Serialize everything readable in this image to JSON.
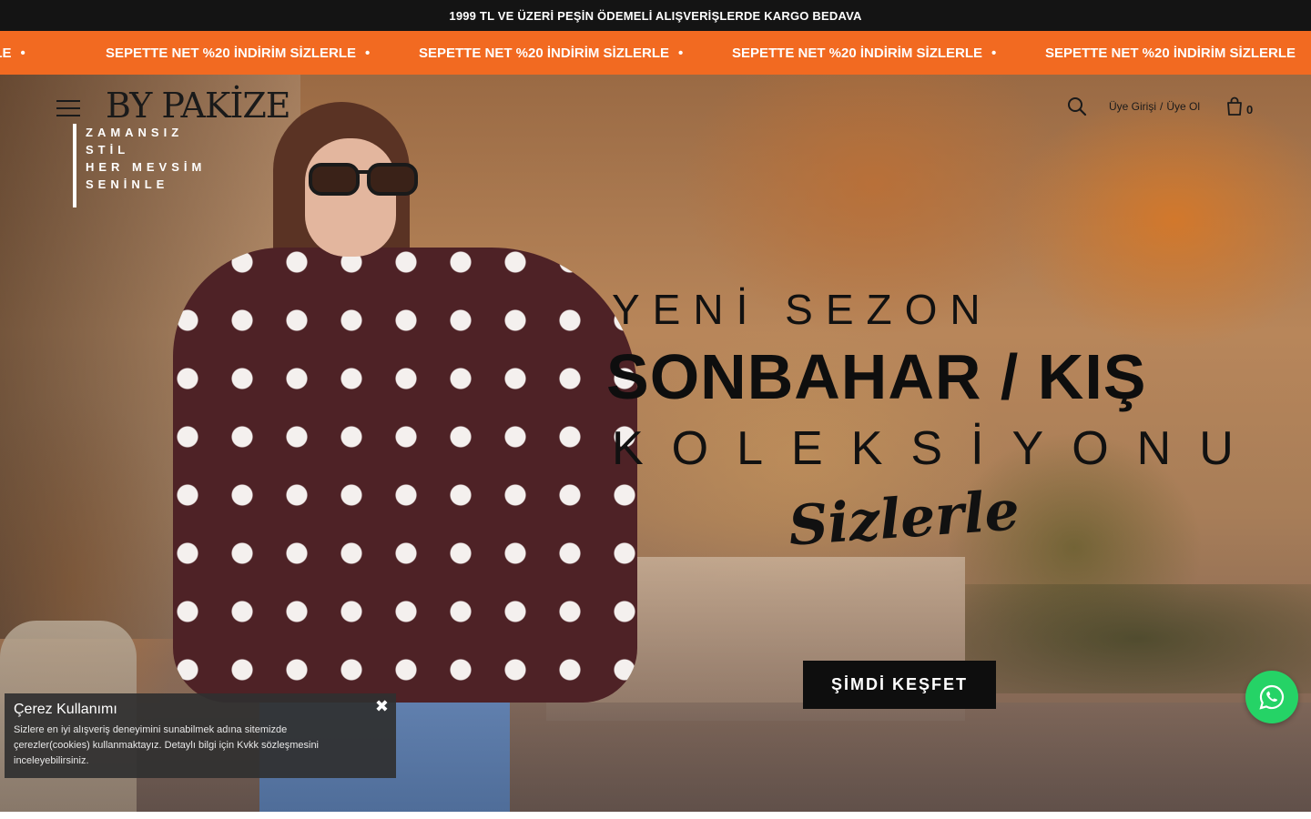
{
  "topbar": {
    "text": "1999 TL VE ÜZERİ PEŞİN ÖDEMELİ ALIŞVERİŞLERDE KARGO BEDAVA"
  },
  "promo_marquee": {
    "items": [
      "İZLERLE",
      "SEPETTE NET %20 İNDİRİM SİZLERLE",
      "SEPETTE NET %20 İNDİRİM SİZLERLE",
      "SEPETTE NET %20 İNDİRİM SİZLERLE",
      "SEPETTE NET %20 İNDİRİM SİZLERLE"
    ],
    "separator": "•",
    "background": "#f26a21"
  },
  "header": {
    "brand": "BY PAKİZE",
    "slogan_lines": [
      "ZAMANSIZ",
      "STİL",
      "HER MEVSİM",
      "SENİNLE"
    ],
    "login_label": "Üye Girişi",
    "divider": "/",
    "register_label": "Üye Ol",
    "cart_count": "0",
    "icons": [
      "menu-icon",
      "search-icon",
      "cart-icon"
    ]
  },
  "hero": {
    "line1": "YENİ SEZON",
    "line2": "SONBAHAR / KIŞ",
    "line3": "KOLEKSİYONU",
    "line4": "Sizlerle",
    "cta_label": "ŞİMDİ KEŞFET"
  },
  "cookie_banner": {
    "title": "Çerez Kullanımı",
    "text": "Sizlere en iyi alışveriş deneyimini sunabilmek adına sitemizde çerezler(cookies) kullanmaktayız. Detaylı bilgi için Kvkk sözleşmesini inceleyebilirsiniz.",
    "close_symbol": "✖"
  },
  "whatsapp": {
    "icon": "whatsapp-icon",
    "color": "#25d366"
  }
}
